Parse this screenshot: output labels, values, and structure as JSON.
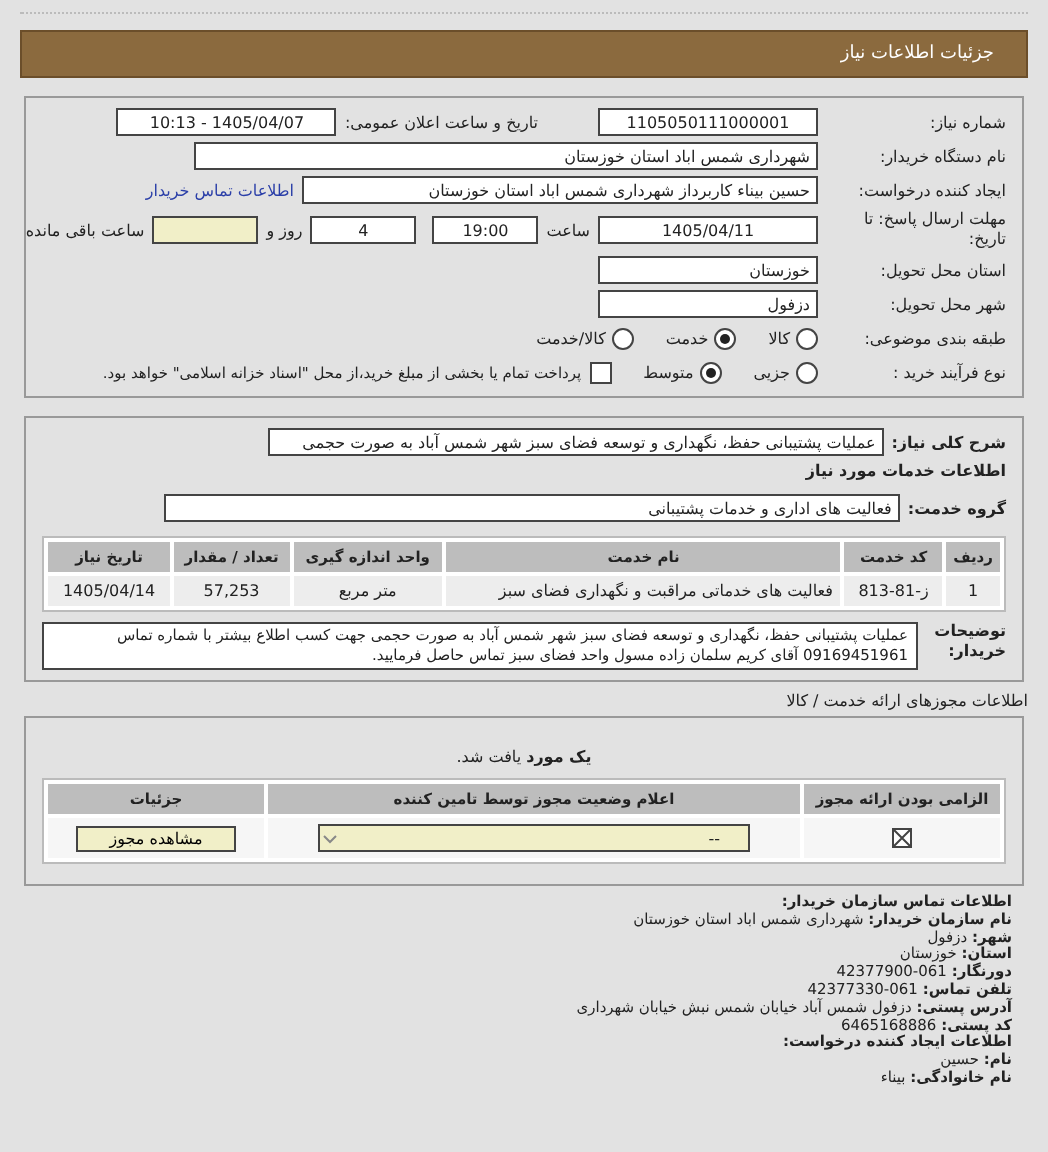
{
  "header": {
    "title": "جزئیات اطلاعات نیاز"
  },
  "details": {
    "need_number": {
      "label": "شماره نیاز:",
      "value": "1105050111000001"
    },
    "announce": {
      "label": "تاریخ و ساعت اعلان عمومی:",
      "value": "1405/04/07 - 10:13"
    },
    "buyer": {
      "label": "نام دستگاه خریدار:",
      "value": "شهرداری شمس اباد استان خوزستان"
    },
    "requester": {
      "label": "ایجاد کننده درخواست:",
      "value": "حسین بیناء کاربرداز شهرداری شمس اباد استان خوزستان",
      "link": "اطلاعات تماس خریدار"
    },
    "deadline": {
      "label": "مهلت ارسال پاسخ: تا تاریخ:",
      "date": "1405/04/11",
      "time_label": "ساعت",
      "time": "19:00",
      "days": "4",
      "days_label": "روز و",
      "remaining_label": "ساعت باقی مانده"
    },
    "province": {
      "label": "استان محل تحویل:",
      "value": "خوزستان"
    },
    "city": {
      "label": "شهر محل تحویل:",
      "value": "دزفول"
    },
    "category": {
      "label": "طبقه بندی موضوعی:",
      "options": [
        {
          "label": "کالا",
          "selected": false
        },
        {
          "label": "خدمت",
          "selected": true
        },
        {
          "label": "کالا/خدمت",
          "selected": false
        }
      ]
    },
    "process": {
      "label": "نوع فرآیند خرید :",
      "options": [
        {
          "label": "جزیی",
          "selected": false
        },
        {
          "label": "متوسط",
          "selected": true
        }
      ],
      "payment": {
        "label": "پرداخت تمام یا بخشی از مبلغ خرید،از محل \"اسناد خزانه اسلامی\" خواهد بود.",
        "checked": false
      }
    }
  },
  "services": {
    "description_label": "شرح کلی نیاز:",
    "description": "عملیات پشتیبانی حفظ، نگهداری و توسعه فضای سبز شهر شمس آباد به صورت حجمی",
    "heading": "اطلاعات خدمات مورد نیاز",
    "group_label": "گروه خدمت:",
    "group": "فعالیت های اداری و خدمات پشتیبانی",
    "columns": [
      "ردیف",
      "کد خدمت",
      "نام خدمت",
      "واحد اندازه گیری",
      "تعداد / مقدار",
      "تاریخ نیاز"
    ],
    "rows": [
      [
        "1",
        "ز-81-813",
        "فعالیت های خدماتی مراقبت و نگهداری فضای سبز",
        "متر مربع",
        "57,253",
        "1405/04/14"
      ]
    ],
    "notes_label": "توضیحات خریدار:",
    "notes": "عملیات پشتیبانی حفظ، نگهداری و توسعه فضای سبز شهر شمس آباد به صورت حجمی جهت کسب اطلاع بیشتر با شماره تماس 09169451961 آقای کریم سلمان زاده مسول واحد فضای سبز تماس حاصل فرمایید."
  },
  "licenses": {
    "title": "اطلاعات مجوزهای ارائه خدمت / کالا",
    "found": "**یک مورد** یافت شد.",
    "columns": [
      "الزامی بودن ارائه مجوز",
      "اعلام وضعیت مجوز توسط تامین کننده",
      "جزئیات"
    ],
    "rows": [
      {
        "required": true,
        "status": "--",
        "action": "مشاهده مجوز"
      }
    ]
  },
  "contact": {
    "heading": "اطلاعات تماس سازمان خریدار:",
    "lines": [
      "**نام سازمان خریدار:** شهرداری شمس اباد استان خوزستان",
      "**شهر:** دزفول",
      "**استان:** خوزستان",
      "**دورنگار:** 061-42377900",
      "**تلفن تماس:** 061-42377330",
      "**آدرس پستی:** دزفول شمس آباد خیابان شمس نبش خیابان شهرداری",
      "**کد پستی:** 6465168886"
    ],
    "creator_heading": "اطلاعات ایجاد کننده درخواست:",
    "creator_lines": [
      "**نام:** حسین",
      "**نام خانوادگی:** بیناء"
    ]
  }
}
